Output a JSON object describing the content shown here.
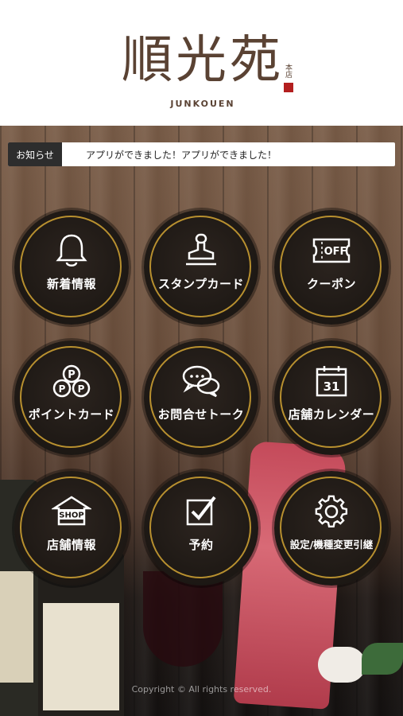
{
  "header": {
    "logo_main": "順光苑",
    "logo_sub": "JUNKOUEN",
    "seal_text": "本店"
  },
  "news": {
    "label": "お知らせ",
    "text": "アプリができました！アプリができました！"
  },
  "menu": [
    {
      "label": "新着情報",
      "icon": "bell-icon"
    },
    {
      "label": "スタンプカード",
      "icon": "stamp-icon"
    },
    {
      "label": "クーポン",
      "icon": "coupon-icon",
      "icon_text": "OFF"
    },
    {
      "label": "ポイントカード",
      "icon": "point-icon",
      "icon_text": "P"
    },
    {
      "label": "お問合せトーク",
      "icon": "chat-icon"
    },
    {
      "label": "店舗カレンダー",
      "icon": "calendar-icon",
      "icon_text": "31"
    },
    {
      "label": "店舗情報",
      "icon": "shop-icon",
      "icon_text": "SHOP"
    },
    {
      "label": "予約",
      "icon": "reservation-icon"
    },
    {
      "label": "設定/機種変更引継",
      "icon": "gear-icon"
    }
  ],
  "footer": {
    "copyright": "Copyright © All rights reserved."
  },
  "colors": {
    "brand": "#5a4233",
    "ring": "#b8902f",
    "seal": "#b31f1f",
    "news_label_bg": "#2d2d2d"
  }
}
